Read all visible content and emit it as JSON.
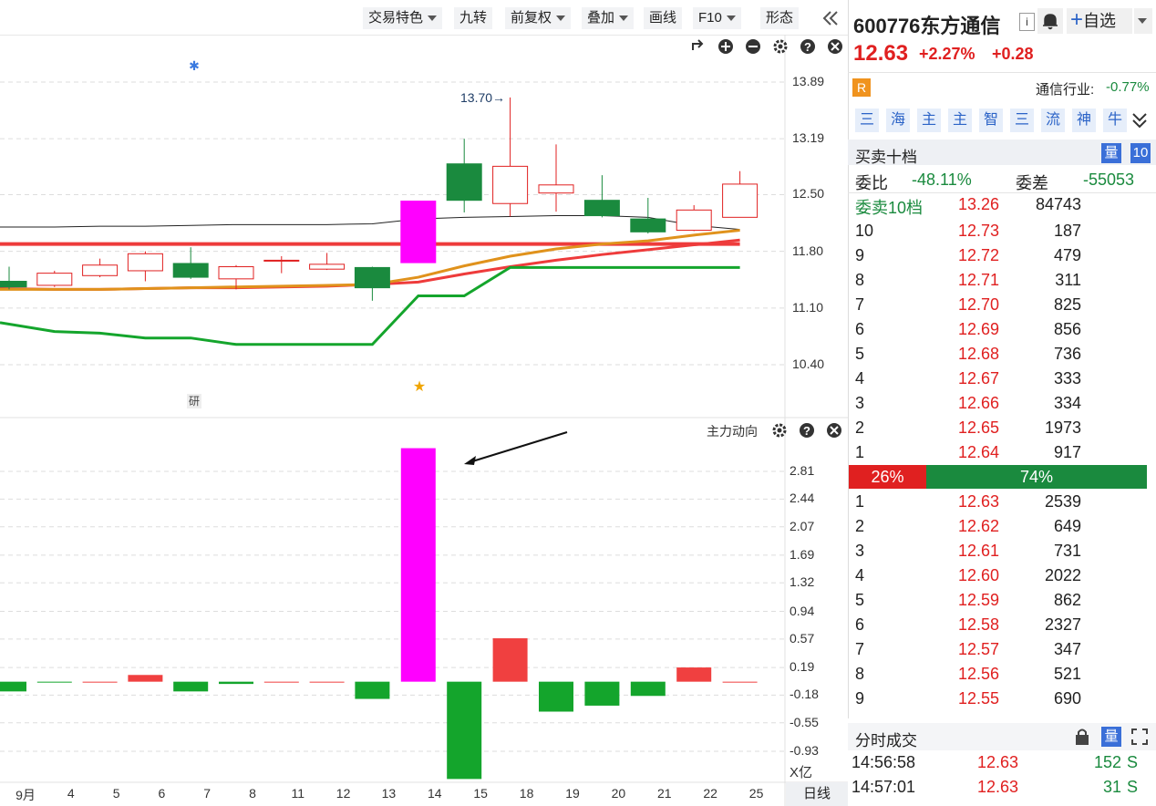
{
  "toolbar": {
    "items": [
      {
        "label": "交易特色",
        "dropdown": true
      },
      {
        "label": "九转",
        "dropdown": false
      },
      {
        "label": "前复权",
        "dropdown": true
      },
      {
        "label": "叠加",
        "dropdown": true
      },
      {
        "label": "画线",
        "dropdown": false
      },
      {
        "label": "F10",
        "dropdown": true
      },
      {
        "label": "形态",
        "dropdown": false
      }
    ],
    "collapse_icon": "double-chevron-left-icon"
  },
  "price_chart": {
    "y_ticks": [
      "13.89",
      "13.19",
      "12.50",
      "11.80",
      "11.10",
      "10.40"
    ],
    "high_annotation": "13.70",
    "badge_text": "研",
    "controls": [
      "undo-icon",
      "zoom-in-icon",
      "zoom-out-icon",
      "gear-icon",
      "help-icon",
      "close-icon"
    ]
  },
  "indicator_chart": {
    "title": "主力动向",
    "y_ticks": [
      "2.81",
      "2.44",
      "2.07",
      "1.69",
      "1.32",
      "0.94",
      "0.57",
      "0.19",
      "-0.18",
      "-0.55",
      "-0.93"
    ],
    "unit": "X亿"
  },
  "x_axis": {
    "labels": [
      "9月",
      "4",
      "5",
      "6",
      "7",
      "8",
      "11",
      "12",
      "13",
      "14",
      "15",
      "18",
      "19",
      "20",
      "21",
      "22",
      "25"
    ],
    "period_button": "日线"
  },
  "quote": {
    "code_name": "600776东方通信",
    "info_icon": "info-icon",
    "bell_icon": "bell-icon",
    "watch_button": "自选",
    "price": "12.63",
    "change_pct": "+2.27%",
    "change": "+0.28",
    "r_badge": "R",
    "industry_label": "通信行业:",
    "industry_change": "-0.77%",
    "tabs": [
      "三",
      "海",
      "主",
      "主",
      "智",
      "三",
      "流",
      "神",
      "牛"
    ]
  },
  "orderbook": {
    "title": "买卖十档",
    "qty_badge": "量",
    "depth_badge": "10",
    "ratio_label": "委比",
    "ratio_value": "-48.11%",
    "diff_label": "委差",
    "diff_value": "-55053",
    "sell10_label": "委卖10档",
    "sell10_price": "13.26",
    "sell10_vol": "84743",
    "asks": [
      {
        "lvl": "10",
        "px": "12.73",
        "vol": "187"
      },
      {
        "lvl": "9",
        "px": "12.72",
        "vol": "479"
      },
      {
        "lvl": "8",
        "px": "12.71",
        "vol": "311"
      },
      {
        "lvl": "7",
        "px": "12.70",
        "vol": "825"
      },
      {
        "lvl": "6",
        "px": "12.69",
        "vol": "856"
      },
      {
        "lvl": "5",
        "px": "12.68",
        "vol": "736"
      },
      {
        "lvl": "4",
        "px": "12.67",
        "vol": "333"
      },
      {
        "lvl": "3",
        "px": "12.66",
        "vol": "334"
      },
      {
        "lvl": "2",
        "px": "12.65",
        "vol": "1973"
      },
      {
        "lvl": "1",
        "px": "12.64",
        "vol": "917"
      }
    ],
    "buy_pct": "26%",
    "sell_pct": "74%",
    "buy_fraction": 0.26,
    "bids": [
      {
        "lvl": "1",
        "px": "12.63",
        "vol": "2539"
      },
      {
        "lvl": "2",
        "px": "12.62",
        "vol": "649"
      },
      {
        "lvl": "3",
        "px": "12.61",
        "vol": "731"
      },
      {
        "lvl": "4",
        "px": "12.60",
        "vol": "2022"
      },
      {
        "lvl": "5",
        "px": "12.59",
        "vol": "862"
      },
      {
        "lvl": "6",
        "px": "12.58",
        "vol": "2327"
      },
      {
        "lvl": "7",
        "px": "12.57",
        "vol": "347"
      },
      {
        "lvl": "8",
        "px": "12.56",
        "vol": "521"
      },
      {
        "lvl": "9",
        "px": "12.55",
        "vol": "690"
      }
    ]
  },
  "trades": {
    "title": "分时成交",
    "rows": [
      {
        "time": "14:56:58",
        "px": "12.63",
        "vol": "152",
        "side": "S"
      },
      {
        "time": "14:57:01",
        "px": "12.63",
        "vol": "31",
        "side": "S"
      }
    ]
  },
  "colors": {
    "up": "#e02020",
    "down": "#1a8a3e",
    "magenta": "#ff00ff",
    "orange": "#e0921c",
    "ma_red": "#ee3b3b",
    "ma_green": "#14a52c"
  },
  "chart_data": {
    "type": "candlestick",
    "dates": [
      "9月",
      "4",
      "5",
      "6",
      "7",
      "8",
      "11",
      "12",
      "13",
      "14",
      "15",
      "18",
      "19",
      "20",
      "21",
      "22",
      "25"
    ],
    "candles": [
      {
        "o": 11.43,
        "c": 11.36,
        "h": 11.61,
        "l": 11.33
      },
      {
        "o": 11.38,
        "c": 11.53,
        "h": 11.56,
        "l": 11.36
      },
      {
        "o": 11.5,
        "c": 11.63,
        "h": 11.71,
        "l": 11.48
      },
      {
        "o": 11.56,
        "c": 11.77,
        "h": 11.8,
        "l": 11.43
      },
      {
        "o": 11.65,
        "c": 11.48,
        "h": 11.85,
        "l": 11.46
      },
      {
        "o": 11.46,
        "c": 11.61,
        "h": 11.63,
        "l": 11.33
      },
      {
        "o": 11.69,
        "c": 11.69,
        "h": 11.74,
        "l": 11.53
      },
      {
        "o": 11.58,
        "c": 11.64,
        "h": 11.78,
        "l": 11.57
      },
      {
        "o": 11.6,
        "c": 11.35,
        "h": 11.61,
        "l": 11.19
      },
      {
        "o": 11.66,
        "c": 12.42,
        "h": 12.42,
        "l": 11.66
      },
      {
        "o": 12.88,
        "c": 12.43,
        "h": 13.19,
        "l": 12.28
      },
      {
        "o": 12.39,
        "c": 12.85,
        "h": 13.7,
        "l": 12.23
      },
      {
        "o": 12.52,
        "c": 12.62,
        "h": 13.12,
        "l": 12.29
      },
      {
        "o": 12.43,
        "c": 12.24,
        "h": 12.74,
        "l": 12.22
      },
      {
        "o": 12.2,
        "c": 12.04,
        "h": 12.46,
        "l": 12.02
      },
      {
        "o": 12.06,
        "c": 12.31,
        "h": 12.37,
        "l": 12.05
      },
      {
        "o": 12.22,
        "c": 12.63,
        "h": 12.79,
        "l": 12.22
      }
    ],
    "ma_black": [
      12.1,
      12.1,
      12.11,
      12.11,
      12.12,
      12.13,
      12.13,
      12.13,
      12.14,
      12.2,
      12.22,
      12.23,
      12.24,
      12.24,
      12.22,
      12.12,
      12.07
    ],
    "ma_orange": [
      11.33,
      11.33,
      11.33,
      11.34,
      11.35,
      11.36,
      11.37,
      11.38,
      11.39,
      11.48,
      11.62,
      11.74,
      11.83,
      11.89,
      11.93,
      12.0,
      12.06
    ],
    "ma_red": [
      11.34,
      11.33,
      11.33,
      11.34,
      11.35,
      11.35,
      11.36,
      11.37,
      11.39,
      11.42,
      11.52,
      11.61,
      11.69,
      11.76,
      11.82,
      11.88,
      11.94
    ],
    "ma_red_flat": 11.89,
    "ma_green": [
      10.92,
      10.81,
      10.79,
      10.73,
      10.73,
      10.65,
      10.65,
      10.65,
      10.65,
      11.25,
      11.25,
      11.6,
      11.6,
      11.6,
      11.6,
      11.6,
      11.6
    ],
    "flow": [
      -0.13,
      -0.01,
      -0.01,
      0.09,
      -0.13,
      -0.03,
      -0.01,
      -0.01,
      -0.23,
      3.12,
      -1.3,
      0.58,
      -0.4,
      -0.32,
      -0.19,
      0.19,
      -0.01
    ],
    "flow_colors": [
      "down",
      "down",
      "up",
      "up",
      "down",
      "down",
      "up",
      "up",
      "down",
      "magenta",
      "down",
      "up",
      "down",
      "down",
      "down",
      "up",
      "up"
    ],
    "price_ylim": [
      10.4,
      13.89
    ],
    "flow_ylim": [
      -0.93,
      2.81
    ]
  }
}
